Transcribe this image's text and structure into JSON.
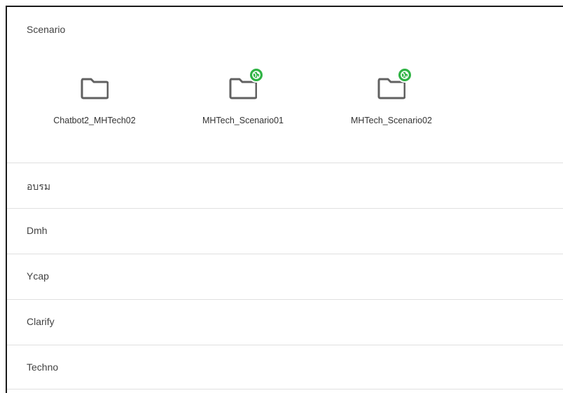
{
  "open_section": {
    "title": "Scenario",
    "folders": [
      {
        "name": "Chatbot2_MHTech02",
        "icon": "folder-icon",
        "shared": false
      },
      {
        "name": "MHTech_Scenario01",
        "icon": "folder-icon",
        "shared": true
      },
      {
        "name": "MHTech_Scenario02",
        "icon": "folder-icon",
        "shared": true
      }
    ],
    "shared_badge_color": "#2fb344",
    "folder_icon_color": "#616161"
  },
  "sections": [
    {
      "title": "อบรม"
    },
    {
      "title": "Dmh"
    },
    {
      "title": "Ycap"
    },
    {
      "title": "Clarify"
    },
    {
      "title": "Techno"
    }
  ],
  "colors": {
    "divider": "#e0e0e0",
    "text": "#424242"
  }
}
